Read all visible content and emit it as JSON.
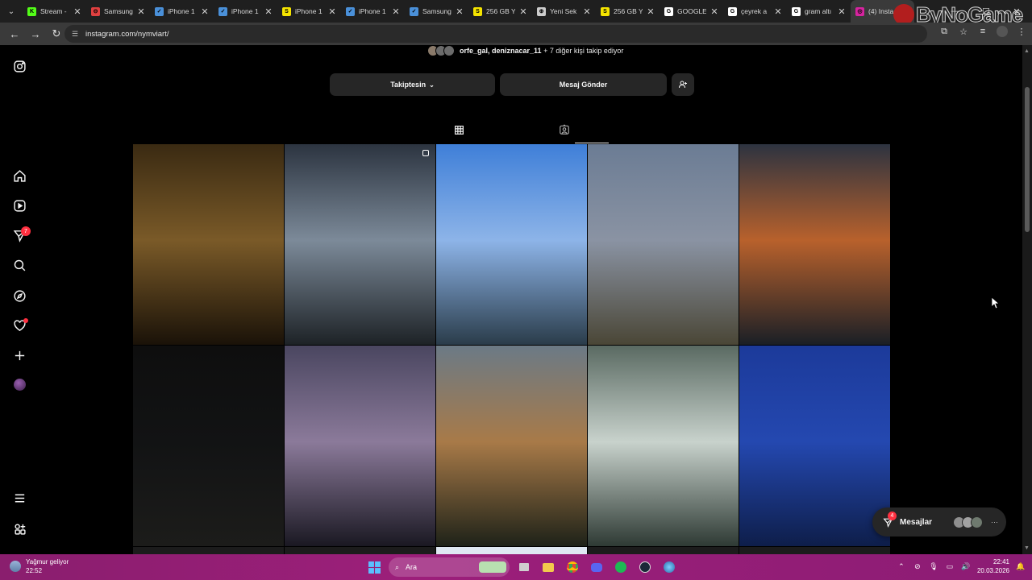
{
  "browser": {
    "tabs": [
      {
        "label": "Stream -",
        "favicon_color": "#53fc18",
        "favicon_glyph": "K"
      },
      {
        "label": "Samsung",
        "favicon_color": "#e04040",
        "favicon_glyph": "⊖"
      },
      {
        "label": "iPhone 1",
        "favicon_color": "#4a90d9",
        "favicon_glyph": "✓"
      },
      {
        "label": "iPhone 1",
        "favicon_color": "#4a90d9",
        "favicon_glyph": "✓"
      },
      {
        "label": "iPhone 1",
        "favicon_color": "#f5e400",
        "favicon_glyph": "S"
      },
      {
        "label": "iPhone 1",
        "favicon_color": "#4a90d9",
        "favicon_glyph": "✓"
      },
      {
        "label": "Samsung",
        "favicon_color": "#4a90d9",
        "favicon_glyph": "✓"
      },
      {
        "label": "256 GB Y",
        "favicon_color": "#f5e400",
        "favicon_glyph": "S"
      },
      {
        "label": "Yeni Sek",
        "favicon_color": "#cccccc",
        "favicon_glyph": "⊕"
      },
      {
        "label": "256 GB Y",
        "favicon_color": "#f5e400",
        "favicon_glyph": "S"
      },
      {
        "label": "GOOGLE",
        "favicon_color": "#ffffff",
        "favicon_glyph": "G"
      },
      {
        "label": "çeyrek a",
        "favicon_color": "#ffffff",
        "favicon_glyph": "G"
      },
      {
        "label": "gram altı",
        "favicon_color": "#ffffff",
        "favicon_glyph": "G"
      },
      {
        "label": "(4) Insta",
        "favicon_color": "#d6249f",
        "favicon_glyph": "◎",
        "active": true
      }
    ],
    "url": "instagram.com/nymviart/",
    "watermark": "ByNoGame"
  },
  "sidebar": {
    "messages_badge": "7",
    "icons": [
      "instagram-logo-icon",
      "home-icon",
      "reels-icon",
      "messages-icon",
      "search-icon",
      "explore-icon",
      "notifications-icon",
      "create-icon",
      "profile-icon",
      "more-menu-icon",
      "meta-apps-icon"
    ]
  },
  "profile": {
    "followed_by_names": "orfe_gal, deniznacar_11",
    "followed_by_rest": "+ 7 diğer kişi takip ediyor",
    "following_button": "Takiptesin",
    "message_button": "Mesaj Gönder"
  },
  "posts": [
    {
      "subject": "hedgehog on dry leaves at night",
      "colors": [
        "#3a2a12",
        "#7a5a28",
        "#1a1208"
      ]
    },
    {
      "subject": "moon over sea behind trees",
      "colors": [
        "#2c3440",
        "#7c8a99",
        "#1d2226"
      ],
      "multi": true
    },
    {
      "subject": "balcony table with sea view",
      "colors": [
        "#3f7fd8",
        "#8db4e8",
        "#2a3c4a"
      ]
    },
    {
      "subject": "cats by iron fence at sea",
      "colors": [
        "#6b7c94",
        "#8a93a3",
        "#4a4636"
      ]
    },
    {
      "subject": "sunset over parked cars",
      "colors": [
        "#2d3340",
        "#b8612c",
        "#1a1f26"
      ]
    },
    {
      "subject": "dark street at night",
      "colors": [
        "#0e0e0e",
        "#121314",
        "#1c1c1a"
      ]
    },
    {
      "subject": "string lights at dusk",
      "colors": [
        "#4a4660",
        "#8b7a9a",
        "#1a1822"
      ]
    },
    {
      "subject": "sunset through trees by building",
      "colors": [
        "#6b7a86",
        "#a87a48",
        "#1e2218"
      ]
    },
    {
      "subject": "sea waves on shore",
      "colors": [
        "#5a6a62",
        "#c8d2cc",
        "#2e3a34"
      ]
    },
    {
      "subject": "blue hour landscape",
      "colors": [
        "#1c3a9a",
        "#2448b0",
        "#0e1e4a"
      ]
    }
  ],
  "messages_dock": {
    "label": "Mesajlar",
    "badge": "4"
  },
  "taskbar": {
    "weather_title": "Yağmur geliyor",
    "weather_time": "22:52",
    "search_placeholder": "Ara",
    "clock_time": "22:41",
    "clock_date": "20.03.2026"
  }
}
